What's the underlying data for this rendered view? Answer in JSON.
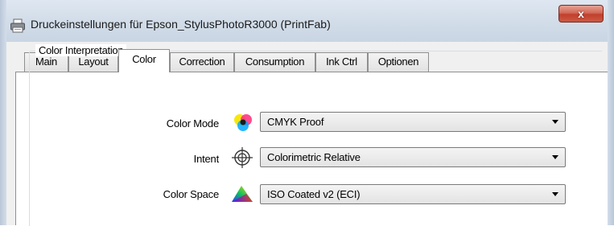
{
  "window": {
    "title": "Druckeinstellungen für Epson_StylusPhotoR3000 (PrintFab)",
    "close_label": "x"
  },
  "tabs": [
    {
      "label": "Main"
    },
    {
      "label": "Layout"
    },
    {
      "label": "Color",
      "active": true
    },
    {
      "label": "Correction"
    },
    {
      "label": "Consumption"
    },
    {
      "label": "Ink Ctrl"
    },
    {
      "label": "Optionen"
    }
  ],
  "group": {
    "label": "Color Interpretation"
  },
  "rows": [
    {
      "label": "Color Mode",
      "icon": "color-mode-icon",
      "value": "CMYK Proof"
    },
    {
      "label": "Intent",
      "icon": "crosshair-icon",
      "value": "Colorimetric Relative"
    },
    {
      "label": "Color Space",
      "icon": "gamut-icon",
      "value": "ISO Coated v2 (ECI)"
    }
  ]
}
